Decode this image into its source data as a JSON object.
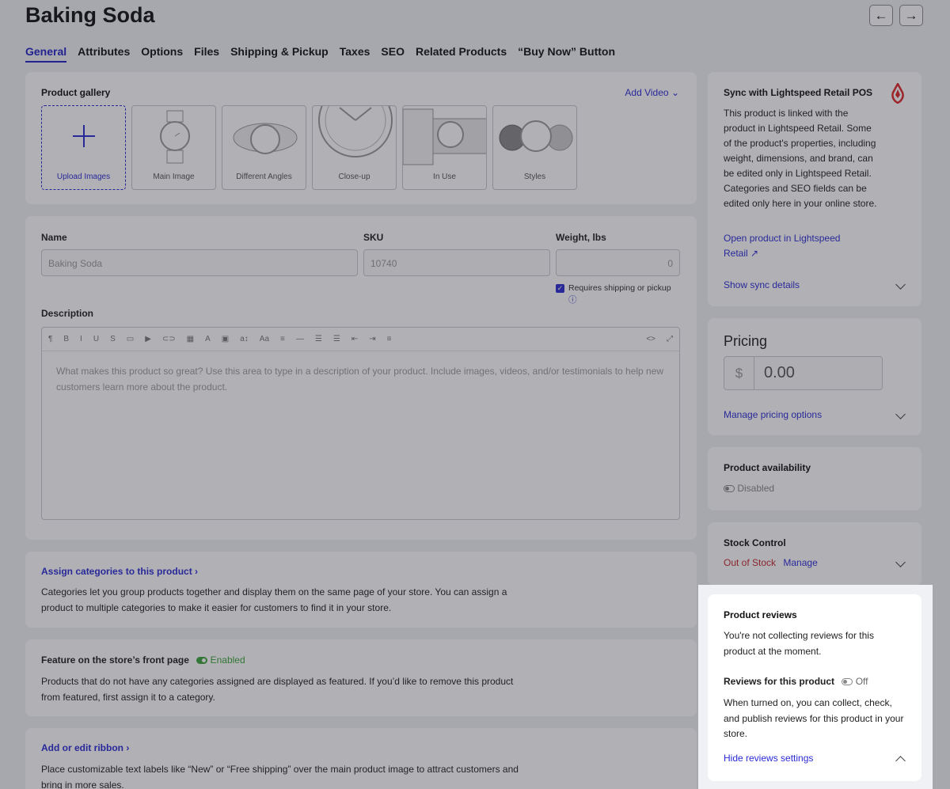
{
  "header": {
    "title": "Baking Soda",
    "prev_icon": "←",
    "next_icon": "→"
  },
  "tabs": [
    "General",
    "Attributes",
    "Options",
    "Files",
    "Shipping & Pickup",
    "Taxes",
    "SEO",
    "Related Products",
    "“Buy Now” Button"
  ],
  "gallery": {
    "label": "Product gallery",
    "add_video": "Add Video",
    "upload_caption": "Upload Images",
    "thumbs": [
      "Main Image",
      "Different Angles",
      "Close-up",
      "In Use",
      "Styles"
    ]
  },
  "form": {
    "name_label": "Name",
    "name_value": "Baking Soda",
    "sku_label": "SKU",
    "sku_value": "10740",
    "weight_label": "Weight, lbs",
    "weight_value": "0",
    "requires_shipping": "Requires shipping or pickup",
    "description_label": "Description",
    "description_placeholder": "What makes this product so great? Use this area to type in a description of your product. Include images, videos, and/or testimonials to help new customers learn more about the product."
  },
  "categories": {
    "link": "Assign categories to this product",
    "text": "Categories let you group products together and display them on the same page of your store. You can assign a product to multiple categories to make it easier for customers to find it in your store."
  },
  "featured": {
    "label": "Feature on the store’s front page",
    "status": "Enabled",
    "text": "Products that do not have any categories assigned are displayed as featured. If you’d like to remove this product from featured, first assign it to a category."
  },
  "ribbon": {
    "link": "Add or edit ribbon",
    "text": "Place customizable text labels like “New” or “Free shipping” over the main product image to attract customers and bring in more sales."
  },
  "sync": {
    "title": "Sync with Lightspeed Retail POS",
    "text": "This product is linked with the product in Lightspeed Retail. Some of the product's properties, including weight, dimensions, and brand, can be edited only in Lightspeed Retail. Categories and SEO fields can be edited only here in your online store.",
    "open_link_1": "Open product in Lightspeed",
    "open_link_2": "Retail",
    "details": "Show sync details"
  },
  "pricing": {
    "title": "Pricing",
    "currency": "$",
    "value": "0.00",
    "manage": "Manage pricing options"
  },
  "availability": {
    "title": "Product availability",
    "status": "Disabled"
  },
  "stock": {
    "title": "Stock Control",
    "status": "Out of Stock",
    "manage": "Manage"
  },
  "reviews": {
    "title": "Product reviews",
    "text": "You're not collecting reviews for this product at the moment.",
    "toggle_label": "Reviews for this product",
    "toggle_status": "Off",
    "toggle_text": "When turned on, you can collect, check, and publish reviews for this product in your store.",
    "hide": "Hide reviews settings"
  }
}
